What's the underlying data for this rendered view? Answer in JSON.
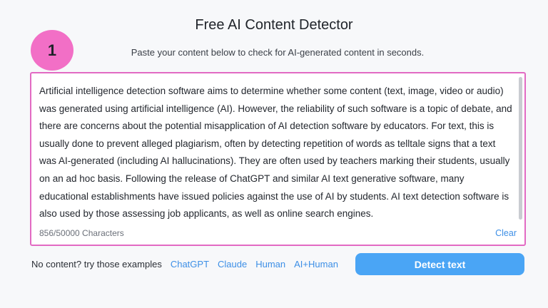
{
  "header": {
    "title": "Free AI Content Detector",
    "subtitle": "Paste your content below to check for AI-generated content in seconds."
  },
  "step_badge": "1",
  "editor": {
    "text": "Artificial intelligence detection software aims to determine whether some content (text, image, video or audio) was generated using artificial intelligence (AI). However, the reliability of such software is a topic of debate, and there are concerns about the potential misapplication of AI detection software by educators. For text, this is usually done to prevent alleged plagiarism, often by detecting repetition of words as telltale signs that a text was AI-generated (including AI hallucinations). They are often used by teachers marking their students, usually on an ad hoc basis. Following the release of ChatGPT and similar AI text generative software, many educational establishments have issued policies against the use of AI by students. AI text detection software is also used by those assessing job applicants, as well as online search engines.",
    "char_count": "856/50000 Characters",
    "clear_label": "Clear"
  },
  "examples": {
    "label": "No content? try those examples",
    "items": [
      "ChatGPT",
      "Claude",
      "Human",
      "AI+Human"
    ]
  },
  "detect_button": "Detect text",
  "colors": {
    "accent": "#4aa5f5",
    "link": "#3d8fe6",
    "highlight": "#e26ac3",
    "badge": "#f26fc6"
  }
}
